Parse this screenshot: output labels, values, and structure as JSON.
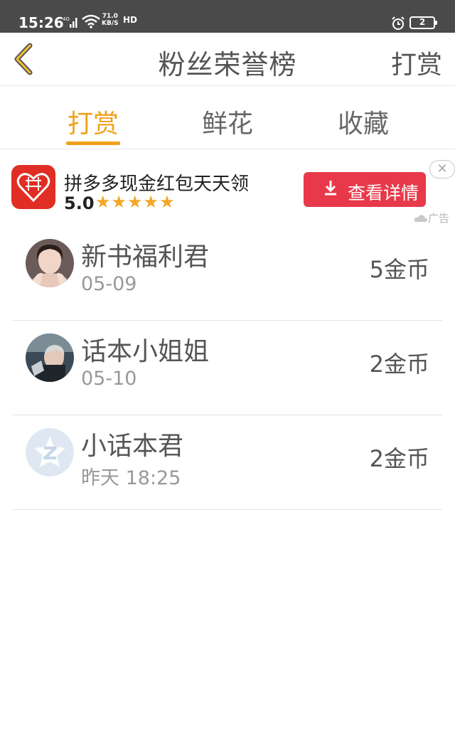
{
  "status_bar": {
    "time": "15:26",
    "network": "4G",
    "speed_value": "71.0",
    "speed_unit": "KB/S",
    "hd": "HD",
    "battery": "2"
  },
  "nav": {
    "title": "粉丝荣誉榜",
    "action": "打赏",
    "back_icon": "chevron-left-icon",
    "accent_color": "#f0a11c"
  },
  "tabs": [
    {
      "label": "打赏",
      "active": true
    },
    {
      "label": "鲜花",
      "active": false
    },
    {
      "label": "收藏",
      "active": false
    }
  ],
  "ad": {
    "title": "拼多多现金红包天天领",
    "rating": "5.0",
    "stars": "★★★★★",
    "button_label": "查看详情",
    "close_glyph": "✕",
    "tag": "广告",
    "button_color": "#e8394a"
  },
  "fans": [
    {
      "name": "新书福利君",
      "date": "05-09",
      "amount": "5金币"
    },
    {
      "name": "话本小姐姐",
      "date": "05-10",
      "amount": "2金币"
    },
    {
      "name": "小话本君",
      "date": "昨天 18:25",
      "amount": "2金币"
    }
  ]
}
